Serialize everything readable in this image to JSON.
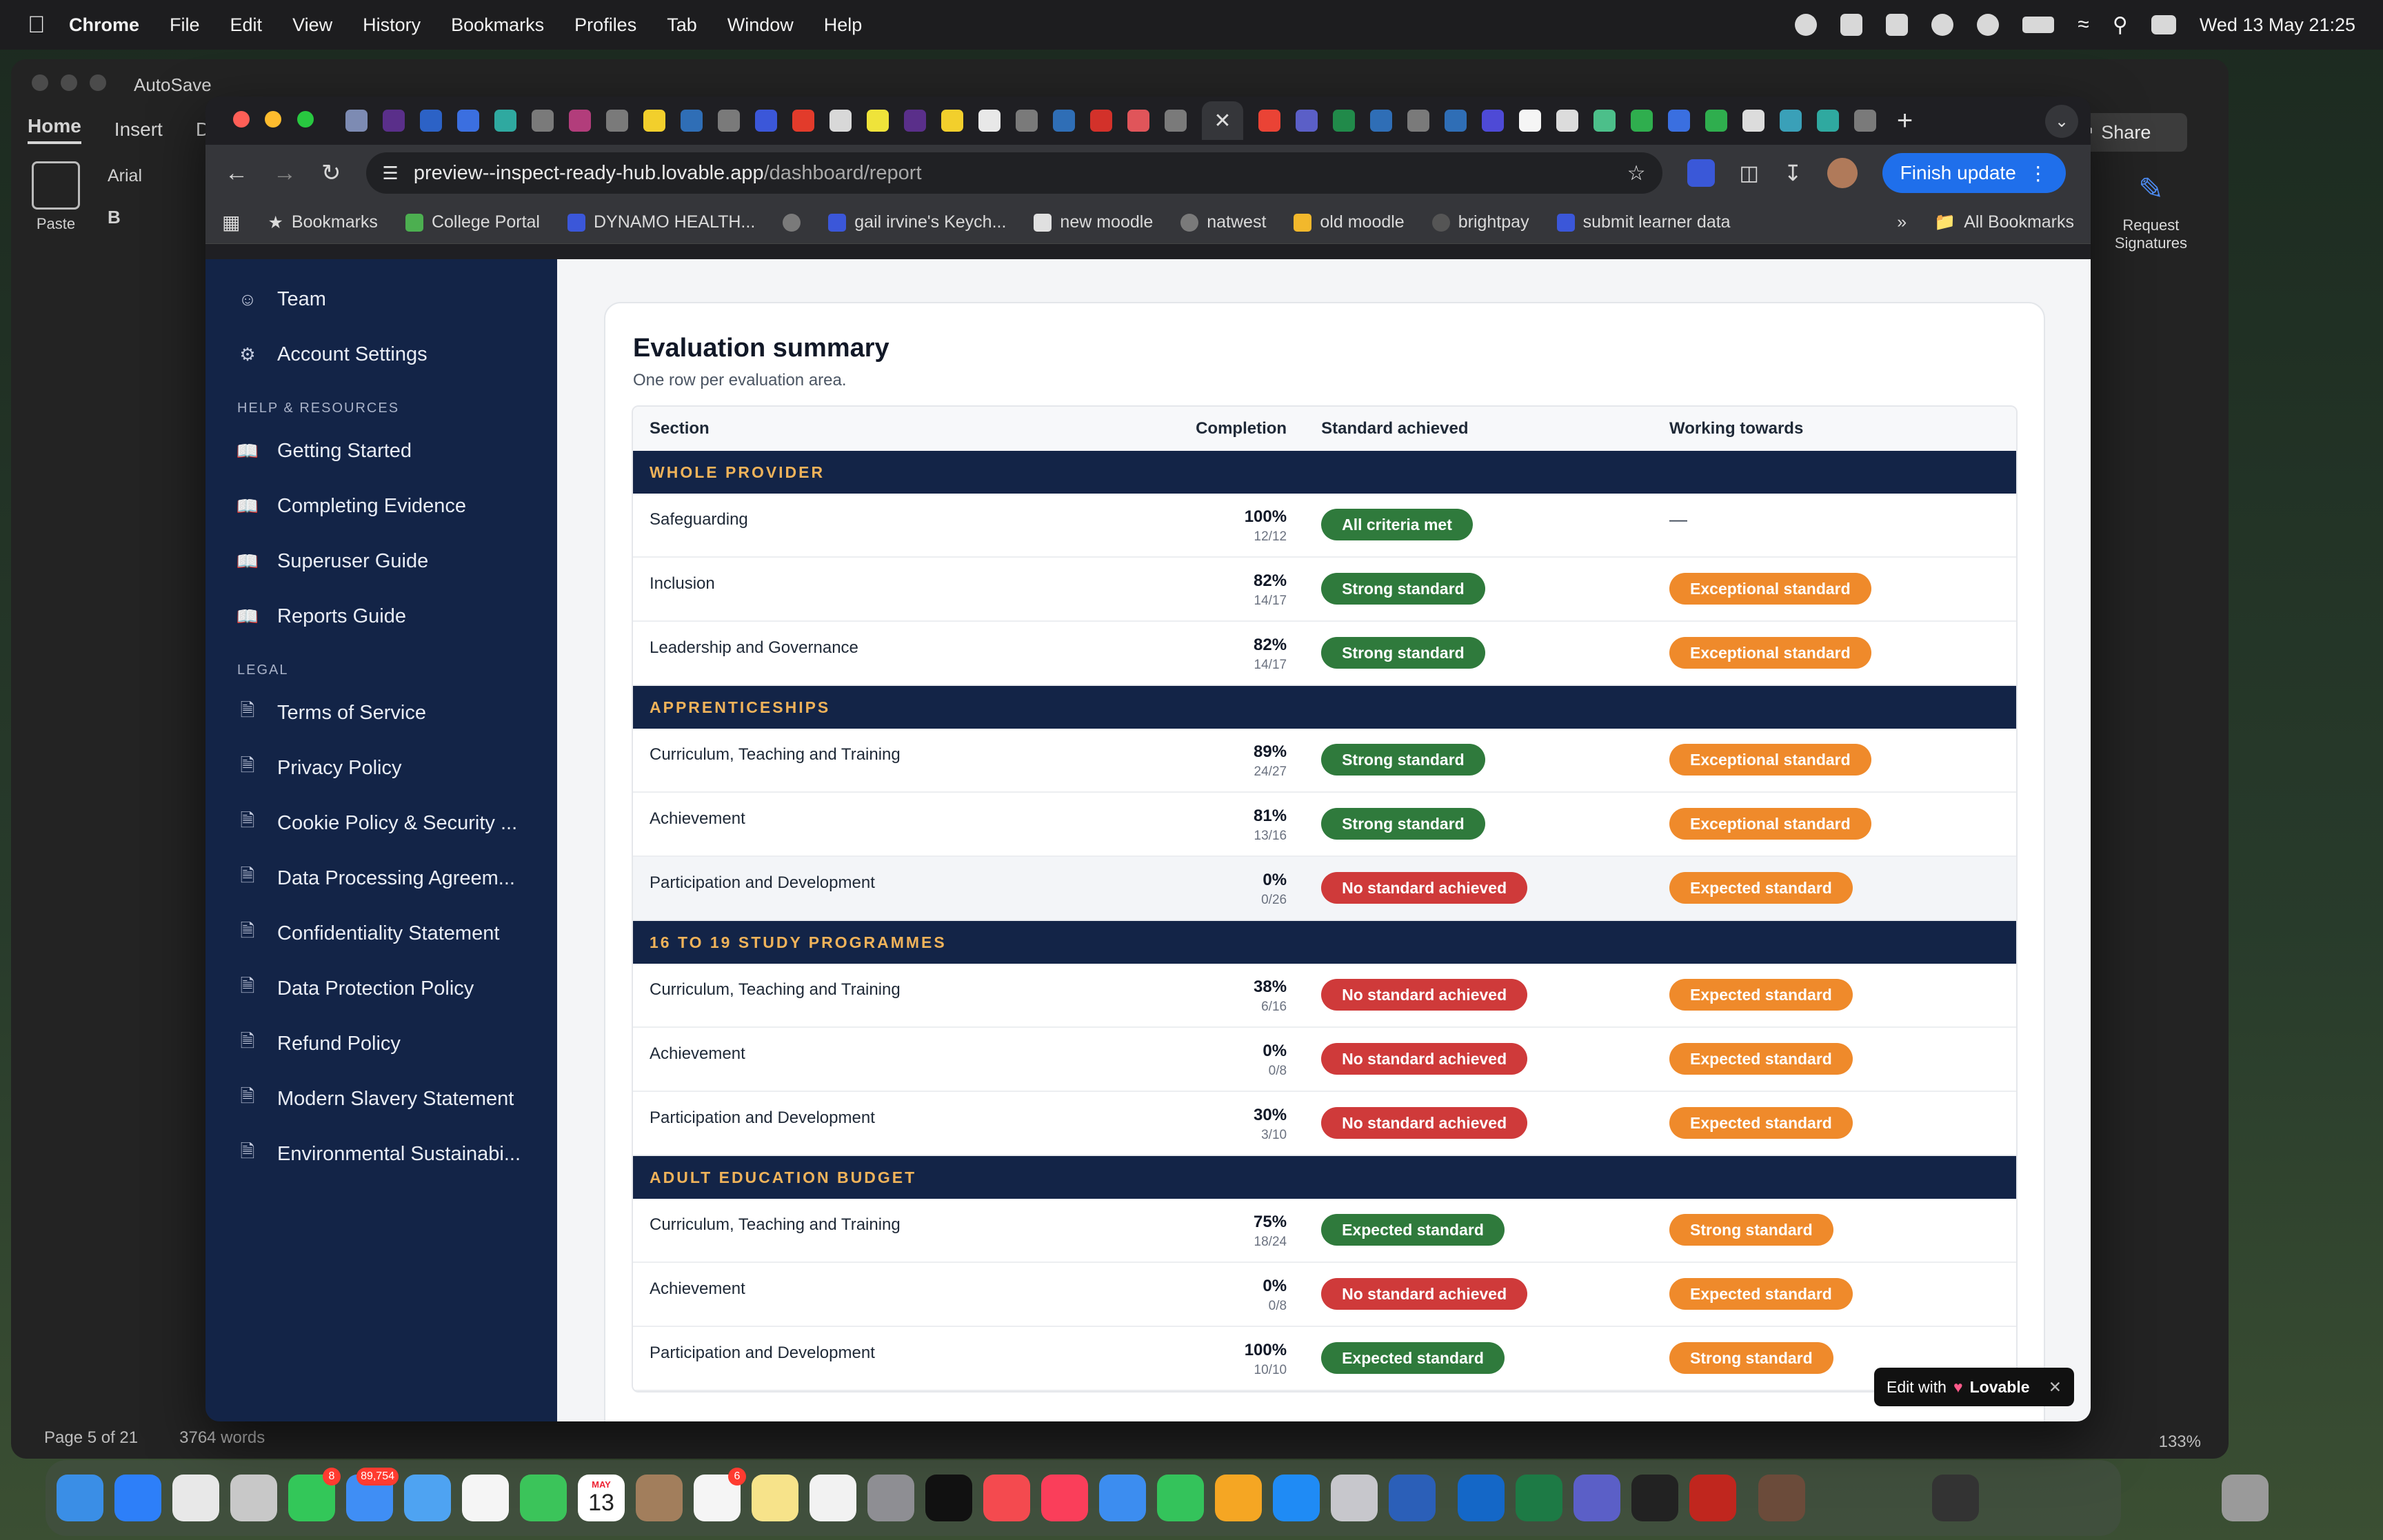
{
  "menubar": {
    "app": "Chrome",
    "items": [
      "File",
      "Edit",
      "View",
      "History",
      "Bookmarks",
      "Profiles",
      "Tab",
      "Window",
      "Help"
    ],
    "clock": "Wed 13 May  21:25"
  },
  "word": {
    "autosave": "AutoSave",
    "tabs": [
      "Home",
      "Insert",
      "D"
    ],
    "paste": "Paste",
    "font": "Arial",
    "bold": "B",
    "share": "Share",
    "request_signatures": "Request\nSignatures",
    "status_page": "Page 5 of 21",
    "status_words": "3764 words",
    "zoom": "133%"
  },
  "browser": {
    "url_host": "preview--inspect-ready-hub.lovable.app",
    "url_path": "/dashboard/report",
    "finish_update": "Finish update",
    "bookmarks": [
      "Bookmarks",
      "College Portal",
      "DYNAMO HEALTH...",
      "gail irvine's Keych...",
      "new moodle",
      "natwest",
      "old moodle",
      "brightpay",
      "submit learner data"
    ],
    "all_bookmarks": "All Bookmarks"
  },
  "sidebar": {
    "top_items": [
      "Team",
      "Account Settings"
    ],
    "help_heading": "HELP & RESOURCES",
    "help_items": [
      "Getting Started",
      "Completing Evidence",
      "Superuser Guide",
      "Reports Guide"
    ],
    "legal_heading": "LEGAL",
    "legal_items": [
      "Terms of Service",
      "Privacy Policy",
      "Cookie Policy & Security ...",
      "Data Processing Agreem...",
      "Confidentiality Statement",
      "Data Protection Policy",
      "Refund Policy",
      "Modern Slavery Statement",
      "Environmental Sustainabi..."
    ]
  },
  "summary": {
    "title": "Evaluation summary",
    "subtitle": "One row per evaluation area.",
    "headers": {
      "section": "Section",
      "completion": "Completion",
      "standard": "Standard achieved",
      "working": "Working towards"
    },
    "groups": [
      {
        "name": "WHOLE PROVIDER",
        "rows": [
          {
            "section": "Safeguarding",
            "pct": "100%",
            "count": "12/12",
            "standard": "All criteria met",
            "standard_color": "green",
            "working": "—",
            "working_color": "none"
          },
          {
            "section": "Inclusion",
            "pct": "82%",
            "count": "14/17",
            "standard": "Strong standard",
            "standard_color": "green",
            "working": "Exceptional standard",
            "working_color": "orange"
          },
          {
            "section": "Leadership and Governance",
            "pct": "82%",
            "count": "14/17",
            "standard": "Strong standard",
            "standard_color": "green",
            "working": "Exceptional standard",
            "working_color": "orange"
          }
        ]
      },
      {
        "name": "APPRENTICESHIPS",
        "rows": [
          {
            "section": "Curriculum, Teaching and Training",
            "pct": "89%",
            "count": "24/27",
            "standard": "Strong standard",
            "standard_color": "green",
            "working": "Exceptional standard",
            "working_color": "orange"
          },
          {
            "section": "Achievement",
            "pct": "81%",
            "count": "13/16",
            "standard": "Strong standard",
            "standard_color": "green",
            "working": "Exceptional standard",
            "working_color": "orange"
          },
          {
            "section": "Participation and Development",
            "pct": "0%",
            "count": "0/26",
            "standard": "No standard achieved",
            "standard_color": "red",
            "working": "Expected standard",
            "working_color": "orange"
          }
        ]
      },
      {
        "name": "16 TO 19 STUDY PROGRAMMES",
        "rows": [
          {
            "section": "Curriculum, Teaching and Training",
            "pct": "38%",
            "count": "6/16",
            "standard": "No standard achieved",
            "standard_color": "red",
            "working": "Expected standard",
            "working_color": "orange"
          },
          {
            "section": "Achievement",
            "pct": "0%",
            "count": "0/8",
            "standard": "No standard achieved",
            "standard_color": "red",
            "working": "Expected standard",
            "working_color": "orange"
          },
          {
            "section": "Participation and Development",
            "pct": "30%",
            "count": "3/10",
            "standard": "No standard achieved",
            "standard_color": "red",
            "working": "Expected standard",
            "working_color": "orange"
          }
        ]
      },
      {
        "name": "ADULT EDUCATION BUDGET",
        "rows": [
          {
            "section": "Curriculum, Teaching and Training",
            "pct": "75%",
            "count": "18/24",
            "standard": "Expected standard",
            "standard_color": "green",
            "working": "Strong standard",
            "working_color": "orange"
          },
          {
            "section": "Achievement",
            "pct": "0%",
            "count": "0/8",
            "standard": "No standard achieved",
            "standard_color": "red",
            "working": "Expected standard",
            "working_color": "orange"
          },
          {
            "section": "Participation and Development",
            "pct": "100%",
            "count": "10/10",
            "standard": "Expected standard",
            "standard_color": "green",
            "working": "Strong standard",
            "working_color": "orange"
          }
        ]
      }
    ]
  },
  "lovable_badge": {
    "prefix": "Edit with",
    "brand": "Lovable"
  },
  "dock": {
    "badges": {
      "messages": "8",
      "mail": "89,754",
      "reminders": "6"
    },
    "calendar_month": "MAY",
    "calendar_day": "13"
  },
  "colors": {
    "sidebar_bg": "#132447",
    "group_text": "#f0b35a",
    "pill_green": "#2f7a3c",
    "pill_red": "#cf3a3a",
    "pill_orange": "#ef8a2b",
    "finish_update": "#1f6feb"
  }
}
